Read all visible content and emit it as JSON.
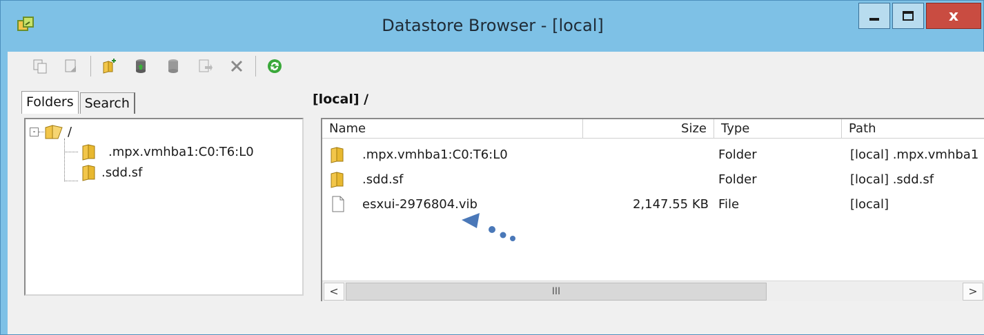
{
  "window": {
    "title": "Datastore Browser - [local]",
    "controls": {
      "minimize_icon": "minimize-icon",
      "maximize_icon": "maximize-icon",
      "close_label": "x"
    }
  },
  "toolbar": {
    "buttons": [
      {
        "icon": "copy-icon",
        "enabled": false
      },
      {
        "icon": "move-icon",
        "enabled": false
      },
      {
        "icon": "new-folder-icon",
        "enabled": true
      },
      {
        "icon": "upload-icon",
        "enabled": true
      },
      {
        "icon": "download-icon",
        "enabled": false
      },
      {
        "icon": "register-vm-icon",
        "enabled": false
      },
      {
        "icon": "delete-icon",
        "enabled": false
      },
      {
        "icon": "refresh-icon",
        "enabled": true
      }
    ]
  },
  "left_panel": {
    "tabs": [
      {
        "label": "Folders",
        "active": true
      },
      {
        "label": "Search",
        "active": false
      }
    ],
    "tree": {
      "root": {
        "label": "/",
        "expander": "-"
      },
      "children": [
        {
          "label": ".mpx.vmhba1:C0:T6:L0"
        },
        {
          "label": ".sdd.sf"
        }
      ]
    }
  },
  "right_panel": {
    "path_label": "[local] /",
    "columns": [
      "Name",
      "Size",
      "Type",
      "Path"
    ],
    "rows": [
      {
        "icon": "folder-icon",
        "name": ".mpx.vmhba1:C0:T6:L0",
        "size": "",
        "type": "Folder",
        "path": "[local] .mpx.vmhba1"
      },
      {
        "icon": "folder-icon",
        "name": ".sdd.sf",
        "size": "",
        "type": "Folder",
        "path": "[local] .sdd.sf"
      },
      {
        "icon": "file-icon",
        "name": "esxui-2976804.vib",
        "size": "2,147.55 KB",
        "type": "File",
        "path": "[local]"
      }
    ],
    "scrollbar": {
      "left": "<",
      "thumb": "III",
      "right": ">"
    }
  },
  "colors": {
    "frame": "#7ec1e6",
    "close": "#c94c41",
    "folder": "#f2c64a",
    "arrow": "#4a78b8"
  }
}
